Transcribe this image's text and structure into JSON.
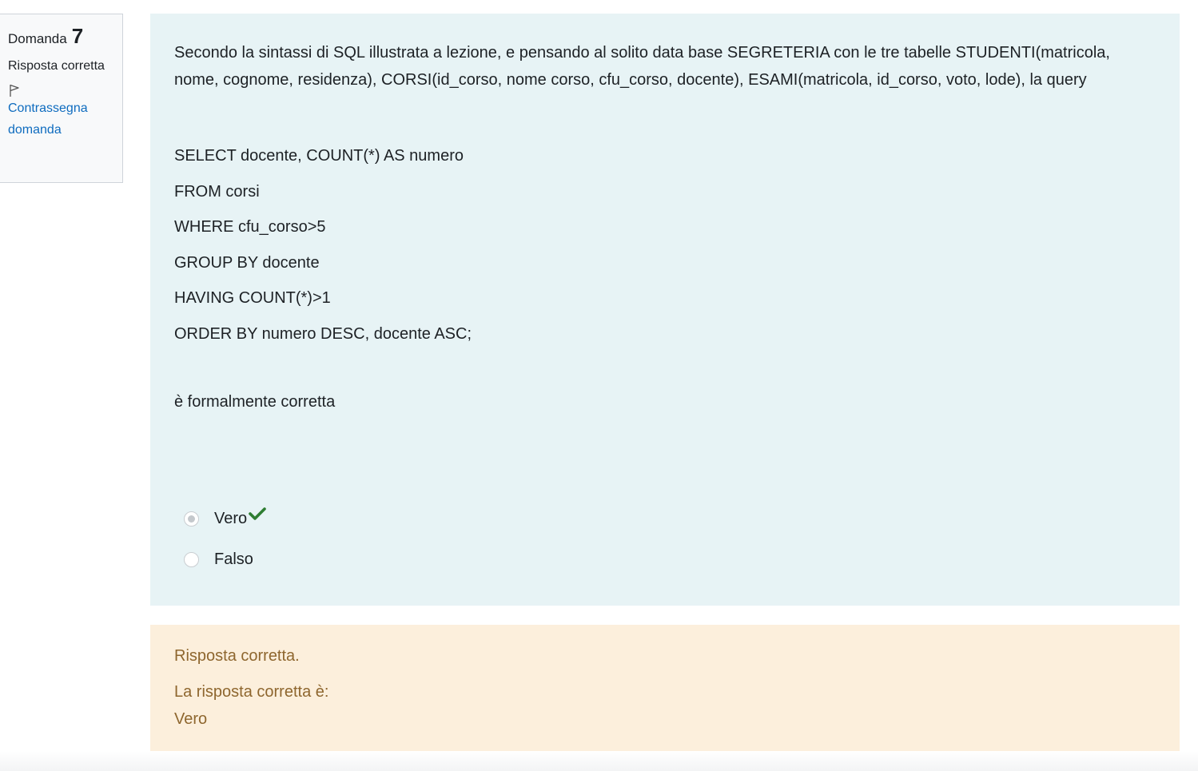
{
  "question_info": {
    "label": "Domanda",
    "number": "7",
    "state": "Risposta corretta",
    "flag_link": "Contrassegna domanda",
    "flag_icon": "flag-outline-icon"
  },
  "question": {
    "intro": "Secondo la sintassi di SQL illustrata a lezione, e pensando al solito data base SEGRETERIA con le tre tabelle STUDENTI(matricola, nome, cognome, residenza), CORSI(id_corso, nome corso, cfu_corso, docente), ESAMI(matricola, id_corso, voto, lode), la query",
    "query_lines": [
      "SELECT docente, COUNT(*) AS numero",
      "FROM corsi",
      "WHERE cfu_corso>5",
      "GROUP BY docente",
      "HAVING COUNT(*)>1",
      "ORDER BY numero DESC, docente ASC;"
    ],
    "conclusion": "è formalmente corretta"
  },
  "answers": [
    {
      "label": "Vero",
      "selected": true,
      "correct_mark": "check-icon"
    },
    {
      "label": "Falso",
      "selected": false
    }
  ],
  "feedback": {
    "status": "Risposta corretta.",
    "correct_answer_label": "La risposta corretta è:",
    "correct_answer_value": "Vero"
  },
  "colors": {
    "formulation_bg": "#e7f3f5",
    "feedback_bg": "#fcefdc",
    "feedback_text": "#8e662e",
    "link": "#0f6cbf",
    "check": "#2e7d32"
  }
}
